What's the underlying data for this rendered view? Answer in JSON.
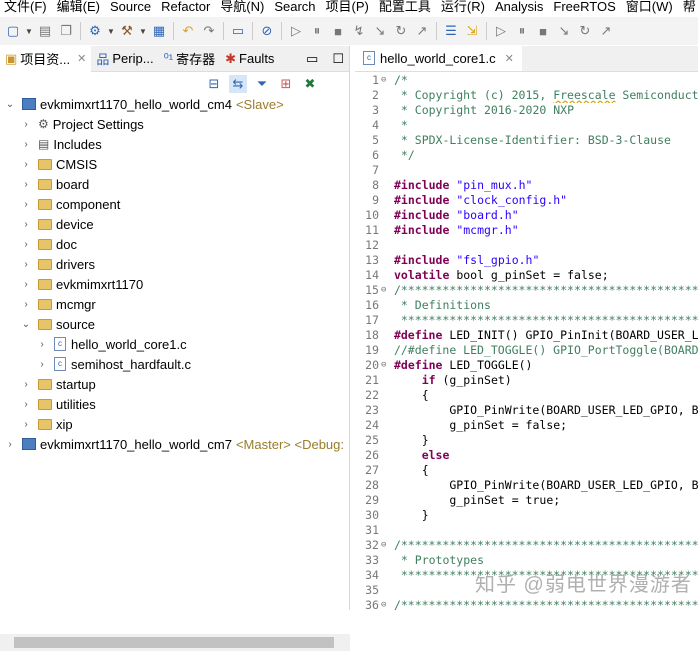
{
  "menu": [
    "文件(F)",
    "编辑(E)",
    "Source",
    "Refactor",
    "导航(N)",
    "Search",
    "项目(P)",
    "配置工具",
    "运行(R)",
    "Analysis",
    "FreeRTOS",
    "窗口(W)",
    "帮"
  ],
  "left_tabs": [
    {
      "label": "项目资...",
      "icon": "project-explorer-icon"
    },
    {
      "label": "Perip...",
      "icon": "peripherals-icon"
    },
    {
      "label": "寄存器",
      "icon": "registers-icon"
    },
    {
      "label": "Faults",
      "icon": "faults-bug-icon"
    }
  ],
  "tree": [
    {
      "label": "evkmimxrt1170_hello_world_cm4",
      "tag": "<Slave>",
      "type": "project",
      "level": 0,
      "expanded": true
    },
    {
      "label": "Project Settings",
      "type": "settings",
      "level": 1
    },
    {
      "label": "Includes",
      "type": "includes",
      "level": 1
    },
    {
      "label": "CMSIS",
      "type": "folder",
      "level": 1
    },
    {
      "label": "board",
      "type": "folder",
      "level": 1
    },
    {
      "label": "component",
      "type": "folder",
      "level": 1
    },
    {
      "label": "device",
      "type": "folder",
      "level": 1
    },
    {
      "label": "doc",
      "type": "folder",
      "level": 1
    },
    {
      "label": "drivers",
      "type": "folder",
      "level": 1
    },
    {
      "label": "evkmimxrt1170",
      "type": "folder",
      "level": 1
    },
    {
      "label": "mcmgr",
      "type": "folder",
      "level": 1
    },
    {
      "label": "source",
      "type": "folder",
      "level": 1,
      "expanded": true
    },
    {
      "label": "hello_world_core1.c",
      "type": "cfile",
      "level": 2
    },
    {
      "label": "semihost_hardfault.c",
      "type": "cfile",
      "level": 2
    },
    {
      "label": "startup",
      "type": "folder",
      "level": 1
    },
    {
      "label": "utilities",
      "type": "folder",
      "level": 1
    },
    {
      "label": "xip",
      "type": "folder",
      "level": 1
    },
    {
      "label": "evkmimxrt1170_hello_world_cm7",
      "tag": "<Master> <Debug:",
      "type": "project",
      "level": 0
    }
  ],
  "editor": {
    "tab": "hello_world_core1.c",
    "lines": [
      [
        [
          "/*",
          "cm"
        ]
      ],
      [
        [
          " * Copyright (c) 2015, ",
          "cm"
        ],
        [
          "Freescale",
          "cm sq"
        ],
        [
          " Semiconduct",
          "cm"
        ]
      ],
      [
        [
          " * Copyright 2016-2020 NXP",
          "cm"
        ]
      ],
      [
        [
          " *",
          "cm"
        ]
      ],
      [
        [
          " * SPDX-License-Identifier: BSD-3-Clause",
          "cm"
        ]
      ],
      [
        [
          " */",
          "cm"
        ]
      ],
      [],
      [
        [
          "#include ",
          "pp"
        ],
        [
          "\"pin_mux.h\"",
          "st"
        ]
      ],
      [
        [
          "#include ",
          "pp"
        ],
        [
          "\"clock_config.h\"",
          "st"
        ]
      ],
      [
        [
          "#include ",
          "pp"
        ],
        [
          "\"board.h\"",
          "st"
        ]
      ],
      [
        [
          "#include ",
          "pp"
        ],
        [
          "\"mcmgr.h\"",
          "st"
        ]
      ],
      [],
      [
        [
          "#include ",
          "pp"
        ],
        [
          "\"fsl_gpio.h\"",
          "st"
        ]
      ],
      [
        [
          "volatile",
          "kw"
        ],
        [
          " bool g_pinSet = false;",
          ""
        ]
      ],
      [
        [
          "/*******************************************",
          "cm"
        ]
      ],
      [
        [
          " * Definitions",
          "cm"
        ]
      ],
      [
        [
          " *******************************************",
          "cm"
        ]
      ],
      [
        [
          "#define",
          "pp"
        ],
        [
          " LED_INIT() GPIO_PinInit(BOARD_USER_L",
          ""
        ]
      ],
      [
        [
          "//#define LED_TOGGLE() GPIO_PortToggle(BOARD",
          "cm"
        ]
      ],
      [
        [
          "#define",
          "pp"
        ],
        [
          " LED_TOGGLE()",
          ""
        ]
      ],
      [
        [
          "    ",
          ""
        ],
        [
          "if",
          "kw"
        ],
        [
          " (g_pinSet)",
          ""
        ]
      ],
      [
        [
          "    {",
          ""
        ]
      ],
      [
        [
          "        GPIO_PinWrite(BOARD_USER_LED_GPIO, B",
          ""
        ]
      ],
      [
        [
          "        g_pinSet = false;",
          ""
        ]
      ],
      [
        [
          "    }",
          ""
        ]
      ],
      [
        [
          "    ",
          ""
        ],
        [
          "else",
          "kw"
        ]
      ],
      [
        [
          "    {",
          ""
        ]
      ],
      [
        [
          "        GPIO_PinWrite(BOARD_USER_LED_GPIO, B",
          ""
        ]
      ],
      [
        [
          "        g_pinSet = true;",
          ""
        ]
      ],
      [
        [
          "    }",
          ""
        ]
      ],
      [],
      [
        [
          "/*******************************************",
          "cm"
        ]
      ],
      [
        [
          " * Prototypes",
          "cm"
        ]
      ],
      [
        [
          " *******************************************",
          "cm"
        ]
      ],
      [],
      [
        [
          "/*******************************************",
          "cm"
        ]
      ]
    ],
    "folds": [
      1,
      15,
      20,
      32,
      36
    ]
  },
  "watermark": "知乎 @弱电世界漫游者"
}
